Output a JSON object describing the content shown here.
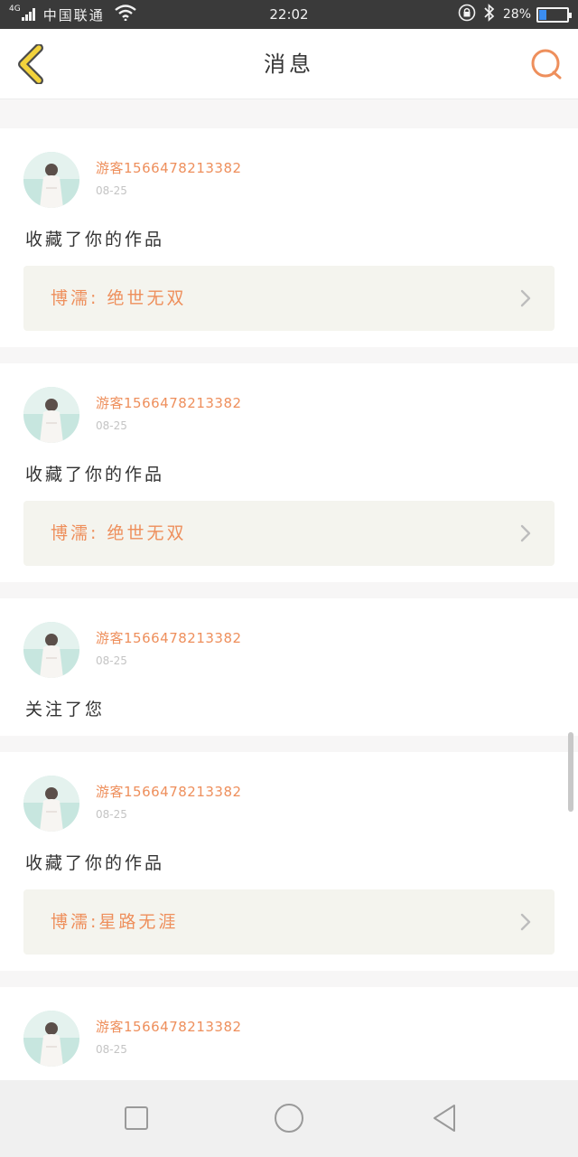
{
  "status_bar": {
    "network": "4G",
    "carrier": "中国联通",
    "time": "22:02",
    "battery": "28%",
    "battery_level": 0.28,
    "icons": [
      "signal-icon",
      "wifi-icon",
      "rotation-lock-icon",
      "bluetooth-icon",
      "battery-icon"
    ]
  },
  "header": {
    "title": "消息",
    "back_icon": "chevron-left-icon",
    "search_icon": "search-icon"
  },
  "colors": {
    "accent": "#ee8f5c",
    "back_icon": "#f2d23c",
    "work_bg": "#f4f4ee",
    "separator": "#f7f6f6"
  },
  "messages": [
    {
      "user": "游客15664782133​82",
      "date": "08-25",
      "action": "收藏了你的作品",
      "work": "博濡: 绝世无双"
    },
    {
      "user": "游客1566478213382",
      "date": "08-25",
      "action": "收藏了你的作品",
      "work": "博濡: 绝世无双"
    },
    {
      "user": "游客1566478213382",
      "date": "08-25",
      "action": "关注了您"
    },
    {
      "user": "游客1566478213382",
      "date": "08-25",
      "action": "收藏了你的作品",
      "work": "博濡:星路无涯"
    },
    {
      "user": "游客1566478213382",
      "date": "08-25"
    }
  ],
  "nav_bar": {
    "items": [
      "square-icon",
      "circle-icon",
      "triangle-back-icon"
    ]
  }
}
